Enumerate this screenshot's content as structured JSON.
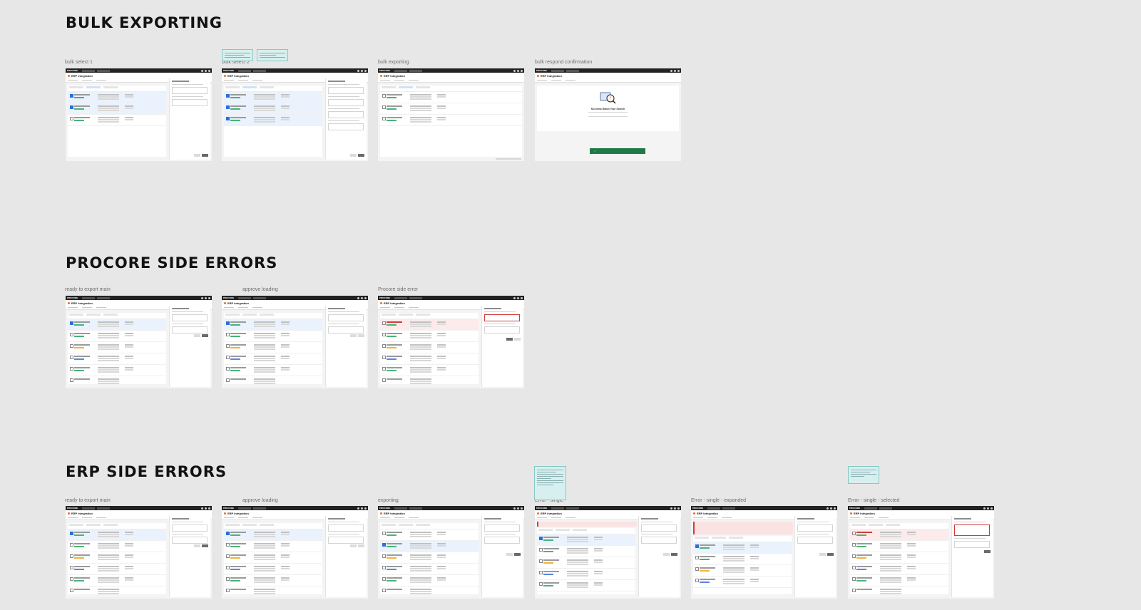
{
  "sections": [
    {
      "title": "BULK EXPORTING",
      "frames": [
        "bulk select 1",
        "bulk select 2",
        "bulk exporting",
        "bulk respond confirmation"
      ]
    },
    {
      "title": "PROCORE SIDE ERRORS",
      "frames": [
        "ready to export main",
        "approve loading",
        "Procore side error"
      ]
    },
    {
      "title": "ERP SIDE ERRORS",
      "frames": [
        "ready to export main",
        "approve loading",
        "exporting",
        "Error - single",
        "Error - single - expanded",
        "Error - single - selected"
      ]
    }
  ],
  "mock_app": {
    "brand": "PROCORE",
    "title": "ERP Integration"
  },
  "empty_state": {
    "message": "No Items Match Your Search"
  },
  "colors": {
    "canvas": "#e7e7e7",
    "accent_orange": "#f26a2e",
    "success_green": "#1f7a46",
    "error_red": "#d33b3b",
    "sticky_note": "#d8efef"
  }
}
